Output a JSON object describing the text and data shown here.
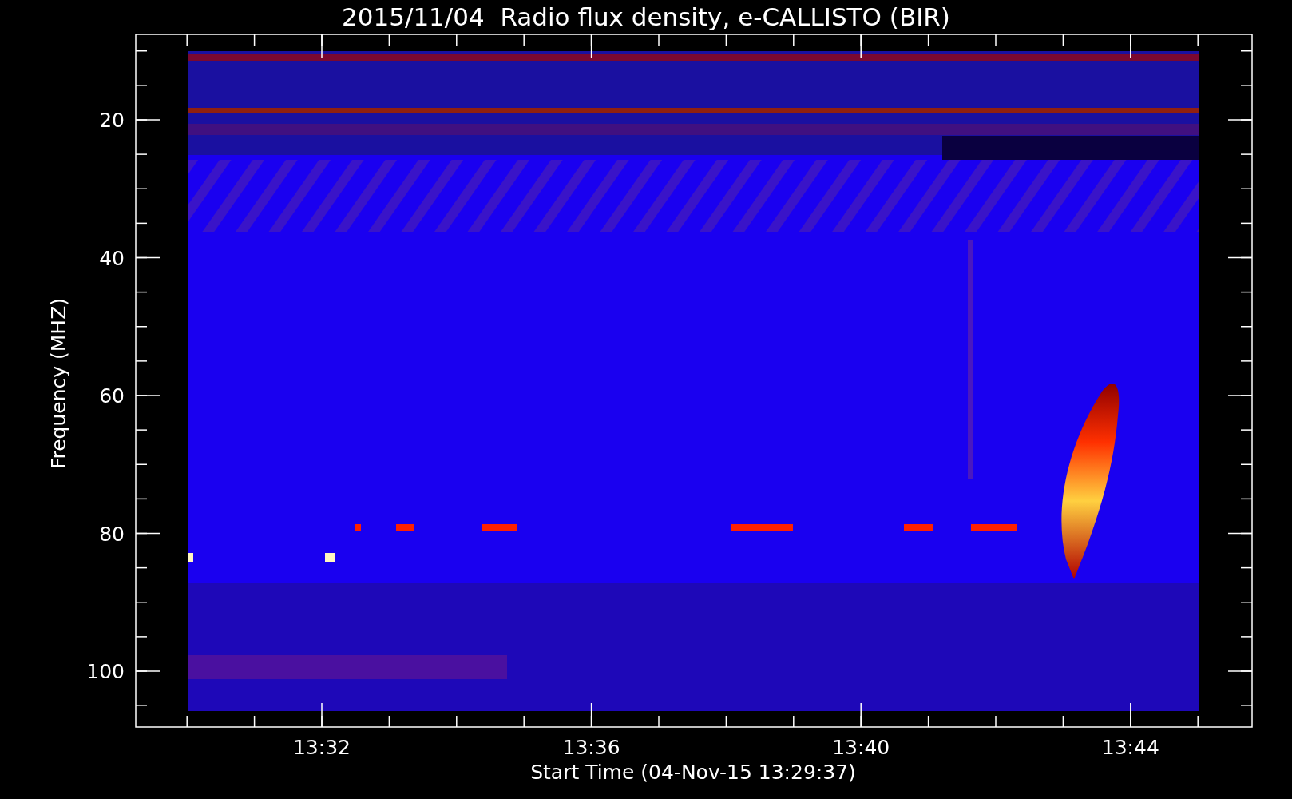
{
  "title": "2015/11/04  Radio flux density, e-CALLISTO (BIR)",
  "y_axis": {
    "label": "Frequency (MHZ)",
    "ticks": [
      "20",
      "40",
      "60",
      "80",
      "100"
    ]
  },
  "x_axis": {
    "label": "Start Time (04-Nov-15 13:29:37)",
    "ticks": [
      "13:32",
      "13:36",
      "13:40",
      "13:44"
    ]
  }
}
